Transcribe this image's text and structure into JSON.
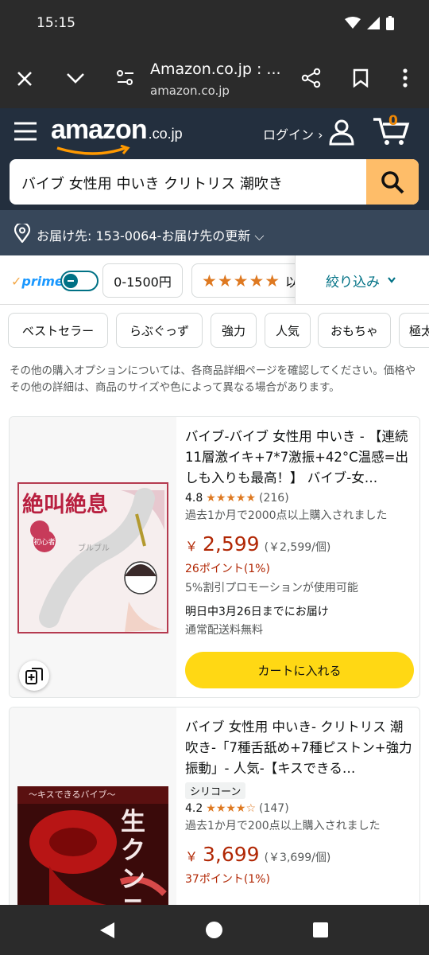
{
  "status": {
    "time": "15:15"
  },
  "browser": {
    "title": "Amazon.co.jp : ...",
    "domain": "amazon.co.jp"
  },
  "header": {
    "logo": "amazon",
    "logo_suffix": ".co.jp",
    "login": "ログイン ›",
    "cart_count": "0"
  },
  "search": {
    "query": "バイブ 女性用 中いき クリトリス 潮吹き"
  },
  "location": {
    "text": "お届け先: 153-0064-お届け先の更新 ⌵"
  },
  "filters": {
    "prime": "prime",
    "price": "0-1500円",
    "stars_label": "以上",
    "refine": "絞り込み",
    "chips": [
      "ベストセラー",
      "らぶぐっず",
      "強力",
      "人気",
      "おもちゃ",
      "極太"
    ]
  },
  "note": "その他の購入オプションについては、各商品詳細ページを確認してください。価格やその他の詳細は、商品のサイズや色によって異なる場合があります。",
  "products": [
    {
      "title": "バイブ-バイブ 女性用 中いき - 【連続11層激イキ+7*7激振+42°C温感=出しも入りも最高！】 バイブ-女…",
      "rating": "4.8",
      "stars": 4.8,
      "reviews": "(216)",
      "bought": "過去1か月で2000点以上購入されました",
      "yen": "￥",
      "price": "2,599",
      "unit_price": "(￥2,599/個)",
      "points": "26ポイント(1%)",
      "promo": "5%割引プロモーションが使用可能",
      "delivery": "明日中3月26日までにお届け",
      "shipping": "通常配送料無料",
      "cart": "カートに入れる",
      "image_text": "絶叫絶息",
      "image_badge": "初心者",
      "image_small": "ブルブル"
    },
    {
      "title": "バイブ 女性用 中いき- クリトリス 潮吹き-「7種舌舐め+7種ピストン+強力振動」- 人気-【キスできる…",
      "tag": "シリコーン",
      "rating": "4.2",
      "stars": 4.2,
      "reviews": "(147)",
      "bought": "過去1か月で200点以上購入されました",
      "yen": "￥",
      "price": "3,699",
      "unit_price": "(￥3,699/個)",
      "points": "37ポイント(1%)",
      "image_text": "〜キスできるバイブ〜",
      "image_big": "生クンニ"
    }
  ],
  "colors": {
    "header": "#232f3e",
    "location": "#37475a",
    "search_btn": "#febd69",
    "cart_btn": "#ffd814",
    "price": "#b12704",
    "star": "#de7921",
    "link": "#007185"
  }
}
